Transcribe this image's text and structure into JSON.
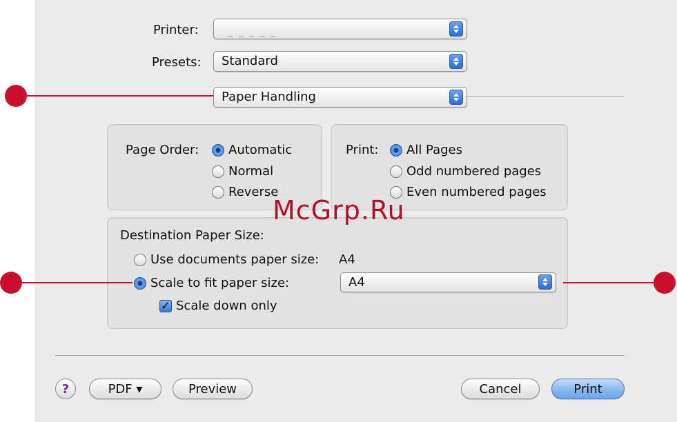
{
  "printer": {
    "label": "Printer:",
    "value": ""
  },
  "presets": {
    "label": "Presets:",
    "value": "Standard"
  },
  "panel_selector": {
    "value": "Paper Handling"
  },
  "page_order": {
    "label": "Page Order:",
    "options": [
      "Automatic",
      "Normal",
      "Reverse"
    ],
    "selected": "Automatic"
  },
  "print_pages": {
    "label": "Print:",
    "options": [
      "All Pages",
      "Odd numbered pages",
      "Even numbered pages"
    ],
    "selected": "All Pages"
  },
  "destination": {
    "label": "Destination Paper Size:",
    "use_documents_label": "Use documents paper size:",
    "use_documents_value": "A4",
    "scale_label": "Scale to fit paper size:",
    "scale_value": "A4",
    "scale_down_label": "Scale down only",
    "selected": "scale",
    "scale_down_checked": true
  },
  "buttons": {
    "help": "?",
    "pdf": "PDF ▾",
    "preview": "Preview",
    "cancel": "Cancel",
    "print": "Print"
  },
  "watermark": "McGrp.Ru",
  "colors": {
    "callout": "#c8102e",
    "default_button": "#6aa3ea",
    "watermark": "#b0102a"
  }
}
